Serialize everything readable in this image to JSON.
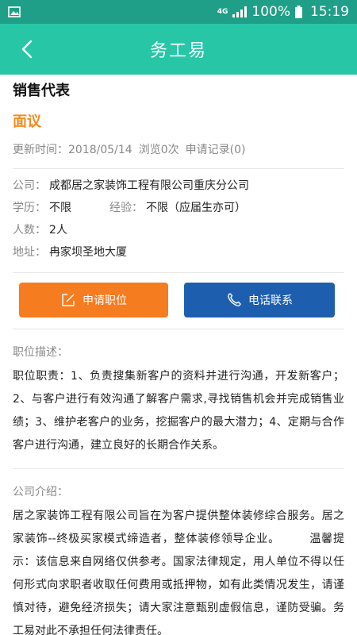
{
  "status_bar": {
    "network": "4G",
    "battery": "100%",
    "time": "15:19"
  },
  "header": {
    "title": "务工易"
  },
  "job": {
    "title": "销售代表",
    "salary": "面议",
    "updated": "更新时间：2018/05/14",
    "views": "浏览0次",
    "applications": "申请记录(0)"
  },
  "info": {
    "company_label": "公司：",
    "company": "成都居之家装饰工程有限公司重庆分公司",
    "education_label": "学历：",
    "education": "不限",
    "experience_label": "经验：",
    "experience": "不限（应届生亦可）",
    "headcount_label": "人数：",
    "headcount": "2人",
    "address_label": "地址：",
    "address": "冉家坝圣地大厦"
  },
  "actions": {
    "apply_label": "申请职位",
    "call_label": "电话联系"
  },
  "description": {
    "title": "职位描述：",
    "body": "职位职责：1、负责搜集新客户的资料并进行沟通，开发新客户；2、与客户进行有效沟通了解客户需求,寻找销售机会并完成销售业绩；3、维护老客户的业务，挖掘客户的最大潜力；4、定期与合作客户进行沟通，建立良好的长期合作关系。"
  },
  "company_intro": {
    "title": "公司介绍：",
    "body": "居之家装饰工程有限公司旨在为客户提供整体装修综合服务。居之家装饰--终极买家模式缔造者，整体装修领导企业。　　　温馨提示：该信息来自网络仅供参考。国家法律规定，用人单位不得以任何形式向求职者收取任何费用或抵押物，如有此类情况发生，请谨慎对待，避免经济损失；请大家注意甄别虚假信息，谨防受骗。务工易对此不承担任何法律责任。"
  },
  "colors": {
    "status_bar": "#1f9f87",
    "header": "#26c6a6",
    "salary": "#f28c1e",
    "apply_button": "#f57c1f",
    "call_button": "#1d5fae"
  }
}
